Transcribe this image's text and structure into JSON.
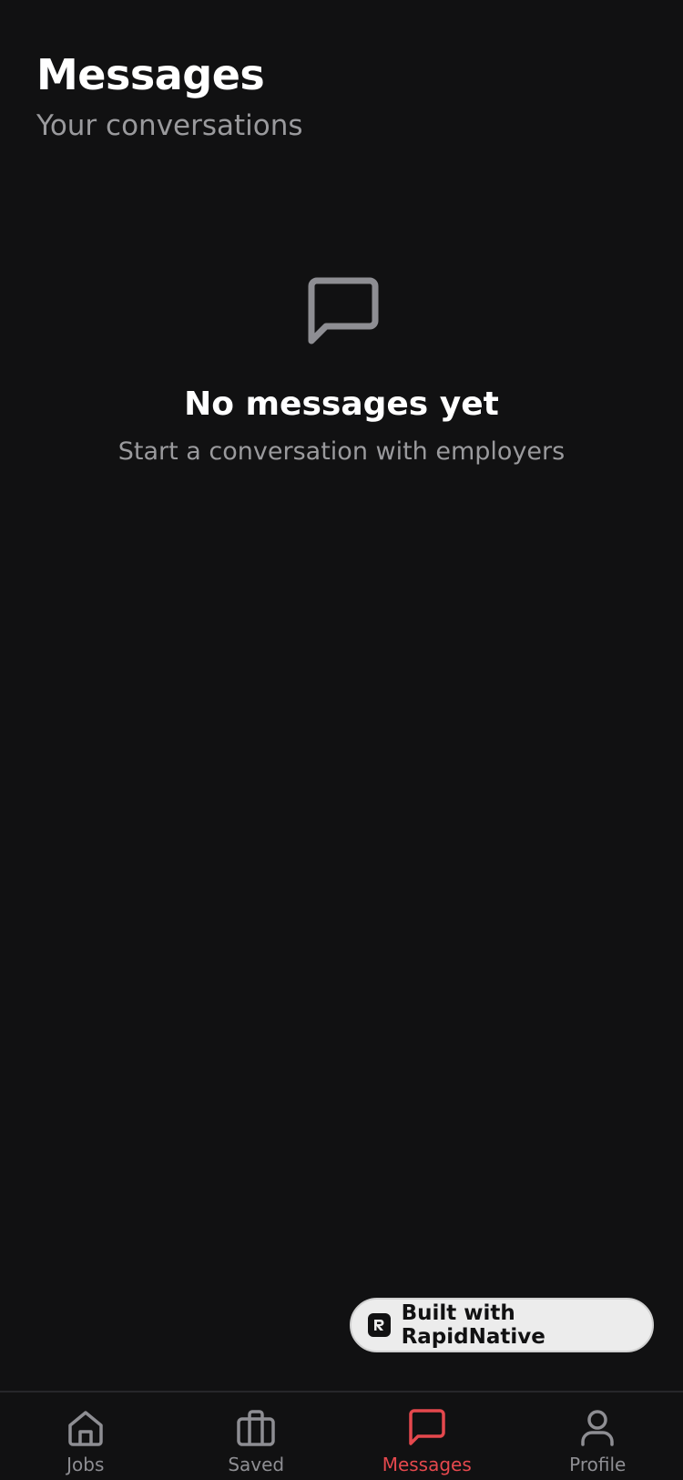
{
  "header": {
    "title": "Messages",
    "subtitle": "Your conversations"
  },
  "empty_state": {
    "icon": "message-square-icon",
    "title": "No messages yet",
    "subtitle": "Start a conversation with employers"
  },
  "badge": {
    "label": "Built with RapidNative",
    "icon": "rapidnative-logo-icon"
  },
  "tabbar": {
    "active_color": "#e5484d",
    "inactive_color": "#8e8e93",
    "items": [
      {
        "label": "Jobs",
        "icon": "home-icon",
        "active": false
      },
      {
        "label": "Saved",
        "icon": "briefcase-icon",
        "active": false
      },
      {
        "label": "Messages",
        "icon": "message-square-icon",
        "active": true
      },
      {
        "label": "Profile",
        "icon": "user-icon",
        "active": false
      }
    ]
  }
}
